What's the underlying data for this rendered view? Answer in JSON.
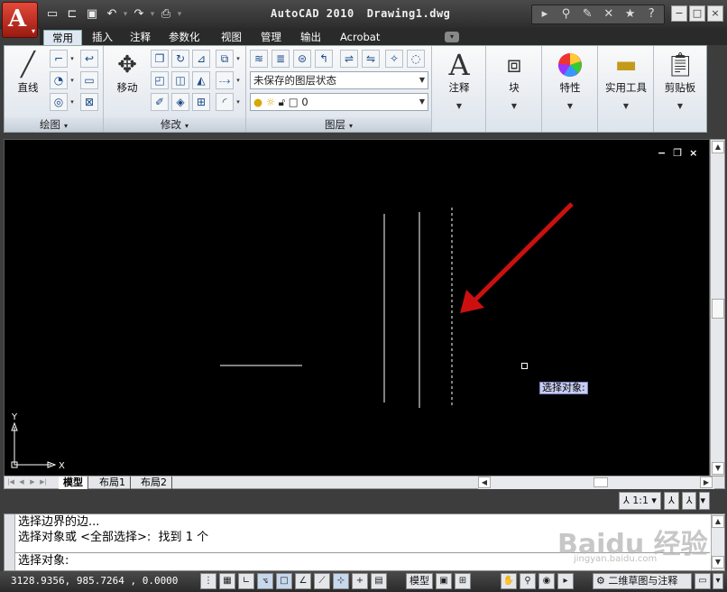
{
  "window": {
    "app_name": "AutoCAD 2010",
    "document": "Drawing1.dwg",
    "app_logo": "A",
    "controls": [
      "−",
      "□",
      "×"
    ]
  },
  "quick_access": {
    "icons": [
      "new-icon",
      "open-icon",
      "save-icon",
      "undo-icon",
      "redo-icon",
      "plot-icon"
    ]
  },
  "tabs": [
    {
      "label": "常用",
      "active": true
    },
    {
      "label": "插入"
    },
    {
      "label": "注释"
    },
    {
      "label": "参数化"
    },
    {
      "label": "视图"
    },
    {
      "label": "管理"
    },
    {
      "label": "输出"
    },
    {
      "label": "Acrobat"
    }
  ],
  "ribbon": {
    "draw": {
      "title": "绘图",
      "line_label": "直线"
    },
    "modify": {
      "title": "修改",
      "move_label": "移动"
    },
    "layers": {
      "title": "图层",
      "layer_state": "未保存的图层状态",
      "current_layer": "0"
    },
    "annotation": {
      "label": "注释",
      "glyph": "A"
    },
    "block": {
      "label": "块"
    },
    "properties": {
      "label": "特性"
    },
    "utilities": {
      "label": "实用工具"
    },
    "clipboard": {
      "label": "剪贴板"
    }
  },
  "viewport": {
    "tooltip": "选择对象:",
    "ucs_y": "Y",
    "ucs_x": "X",
    "win_controls": [
      "−",
      "❐",
      "×"
    ]
  },
  "layout_tabs": [
    "模型",
    "布局1",
    "布局2"
  ],
  "annotation_scale": "1:1",
  "command": {
    "history": [
      "选择边界的边...",
      "选择对象或 <全部选择>:  找到 1 个"
    ],
    "prompt": "选择对象:"
  },
  "status": {
    "coords": "3128.9356, 985.7264 , 0.0000",
    "model_label": "模型",
    "workspace": "二维草图与注释"
  },
  "watermark": {
    "text": "Baidu 经验",
    "sub": "jingyan.baidu.com"
  },
  "colors": {
    "canvas": "#000000",
    "arrow": "#cc1010",
    "line": "#ffffff"
  }
}
